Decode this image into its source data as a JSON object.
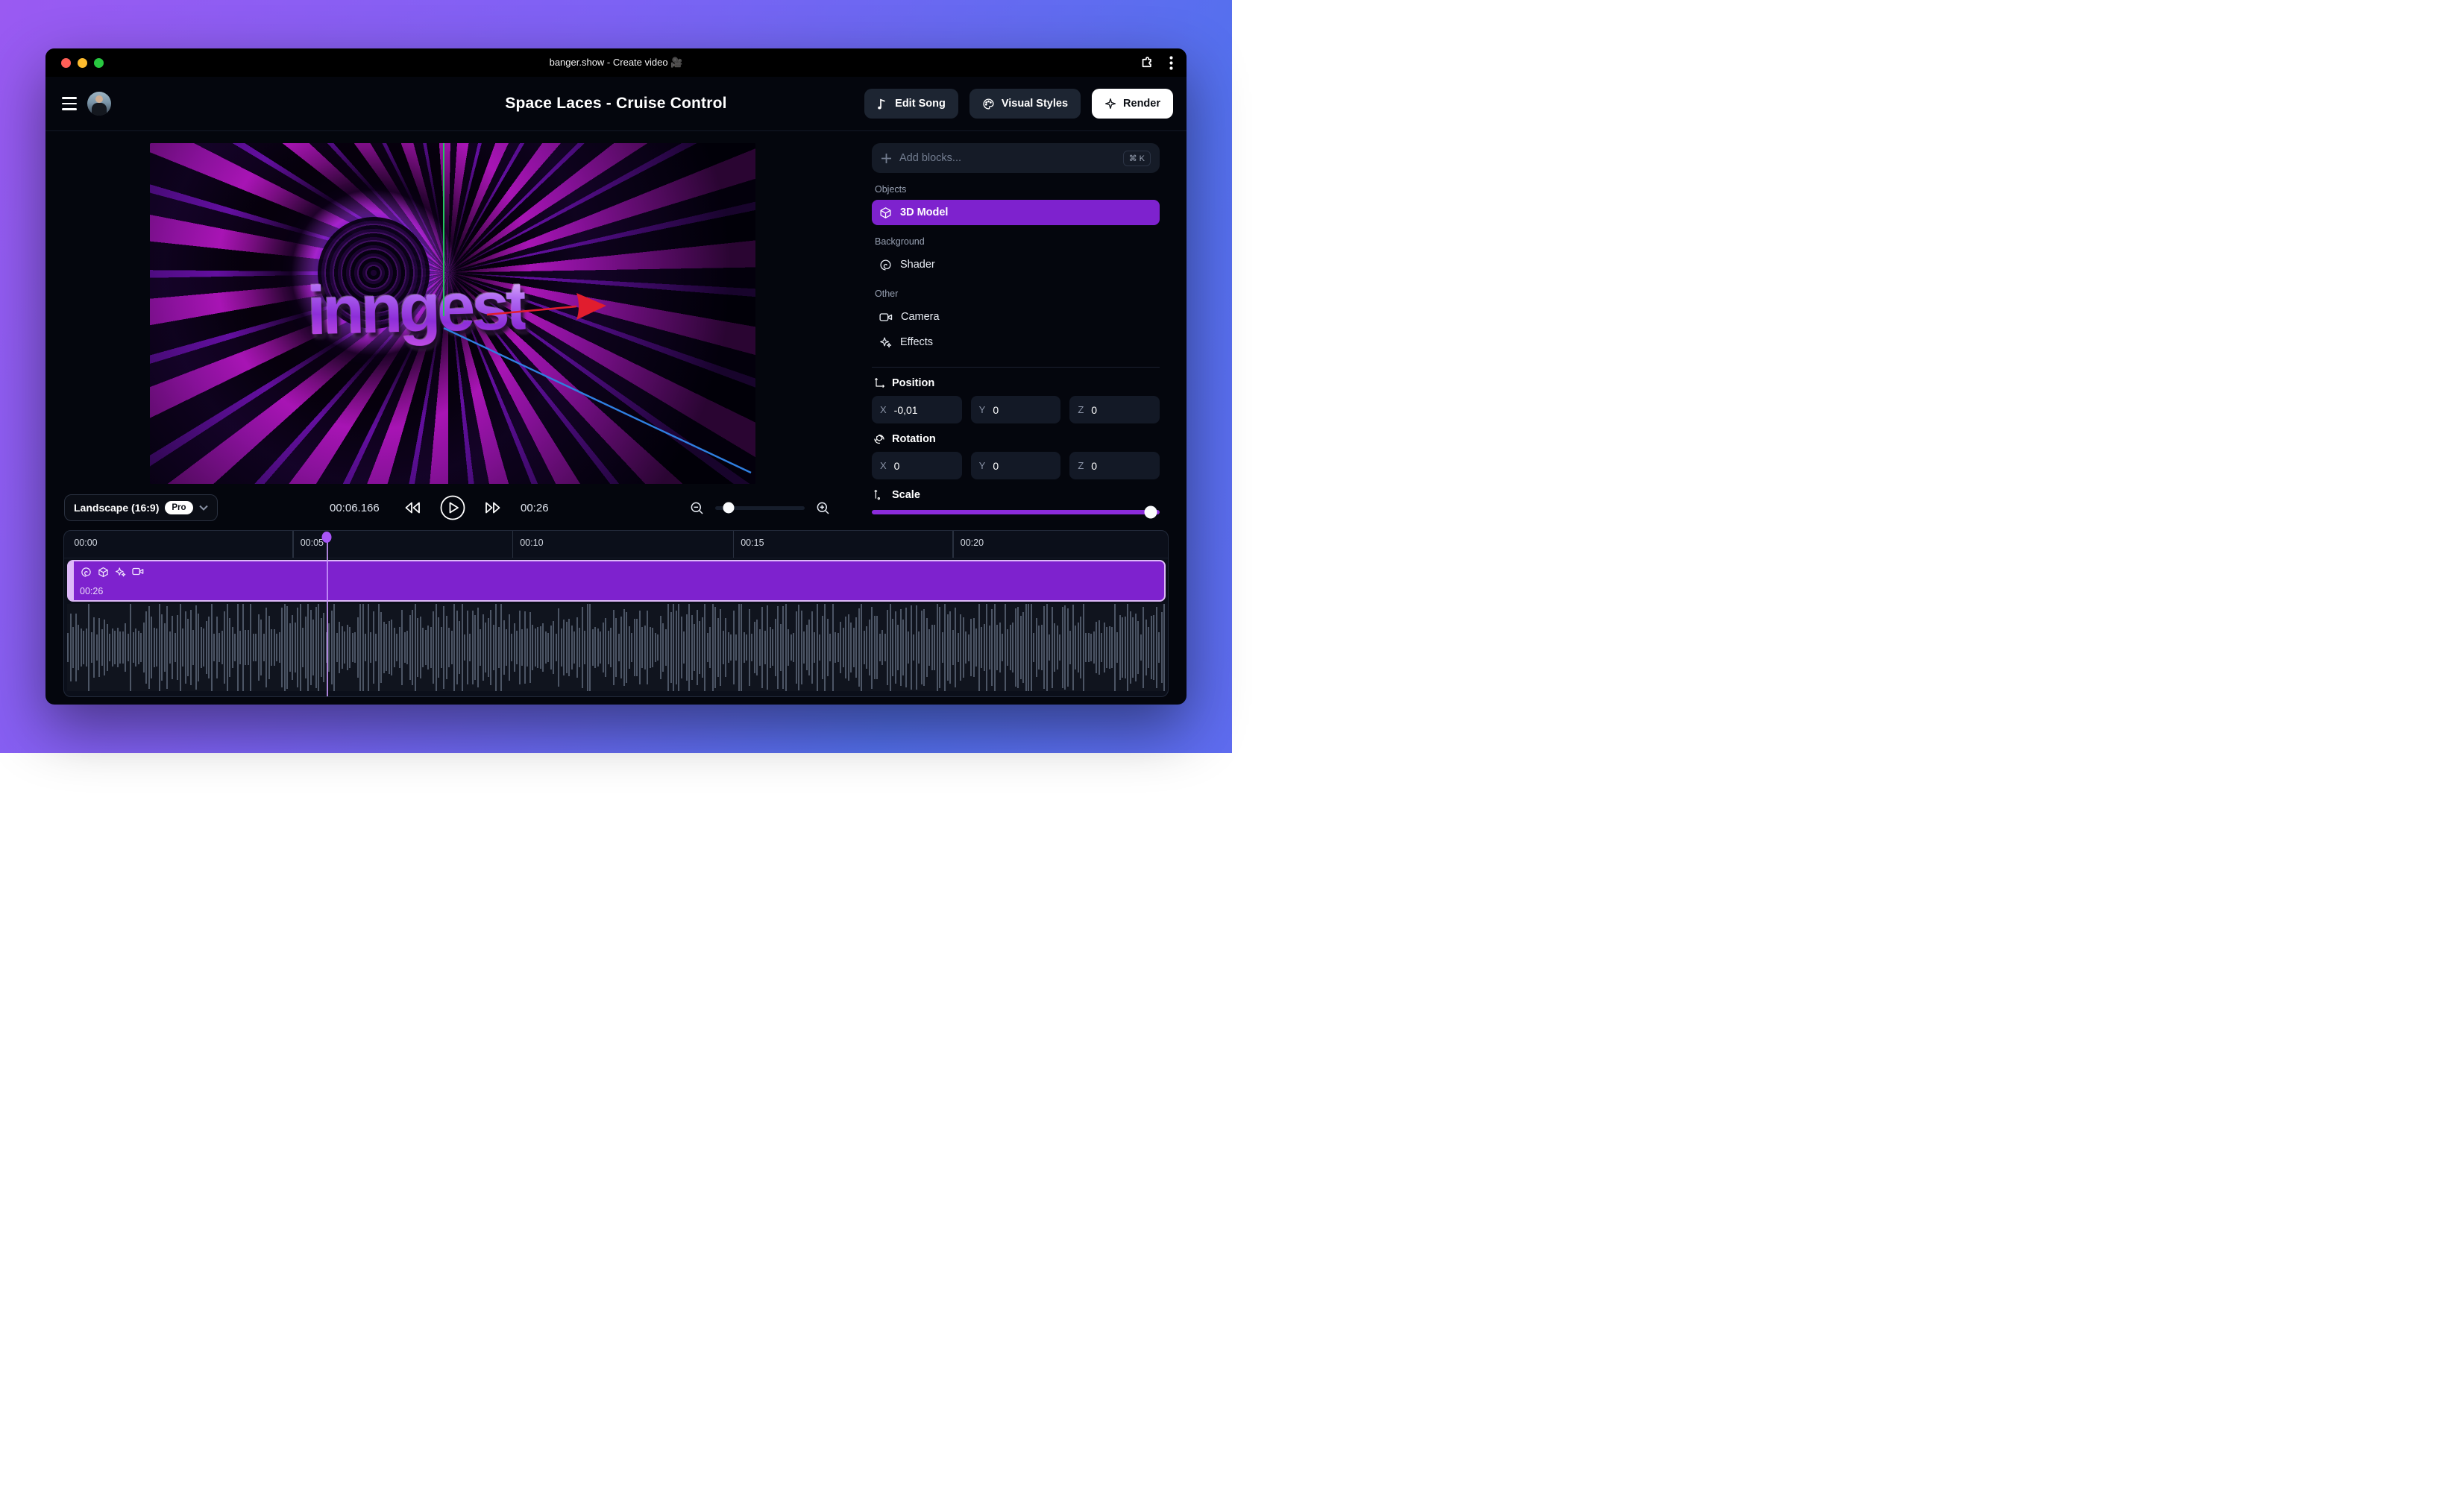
{
  "titlebar": {
    "title": "banger.show - Create video 🎥"
  },
  "header": {
    "project_title": "Space Laces - Cruise Control",
    "edit_song_label": "Edit Song",
    "visual_styles_label": "Visual Styles",
    "render_label": "Render"
  },
  "preview": {
    "logo_text": "inngest"
  },
  "player": {
    "aspect_label": "Landscape (16:9)",
    "pro_badge": "Pro",
    "current_time": "00:06.166",
    "duration": "00:26",
    "zoom_pct": 15
  },
  "sidebar": {
    "add_blocks_placeholder": "Add blocks...",
    "shortcut": "⌘ K",
    "objects_label": "Objects",
    "model_item": "3D Model",
    "background_label": "Background",
    "shader_item": "Shader",
    "other_label": "Other",
    "camera_item": "Camera",
    "effects_item": "Effects",
    "position": {
      "title": "Position",
      "x_label": "X",
      "x": "-0,01",
      "y_label": "Y",
      "y": "0",
      "z_label": "Z",
      "z": "0"
    },
    "rotation": {
      "title": "Rotation",
      "x_label": "X",
      "x": "0",
      "y_label": "Y",
      "y": "0",
      "z_label": "Z",
      "z": "0"
    },
    "scale": {
      "title": "Scale",
      "value_pct": 97
    }
  },
  "timeline": {
    "ticks": [
      "00:00",
      "00:05",
      "00:10",
      "00:15",
      "00:20"
    ],
    "tick_positions_pct": [
      0.7,
      20.7,
      40.6,
      60.6,
      80.5
    ],
    "clip_duration": "00:26",
    "playhead_pct": 23.8
  },
  "colors": {
    "accent_purple": "#7e22ce",
    "clip_border": "#ddb9f8",
    "slider_purple": "#8b2bdb",
    "playhead": "#a855f7"
  }
}
